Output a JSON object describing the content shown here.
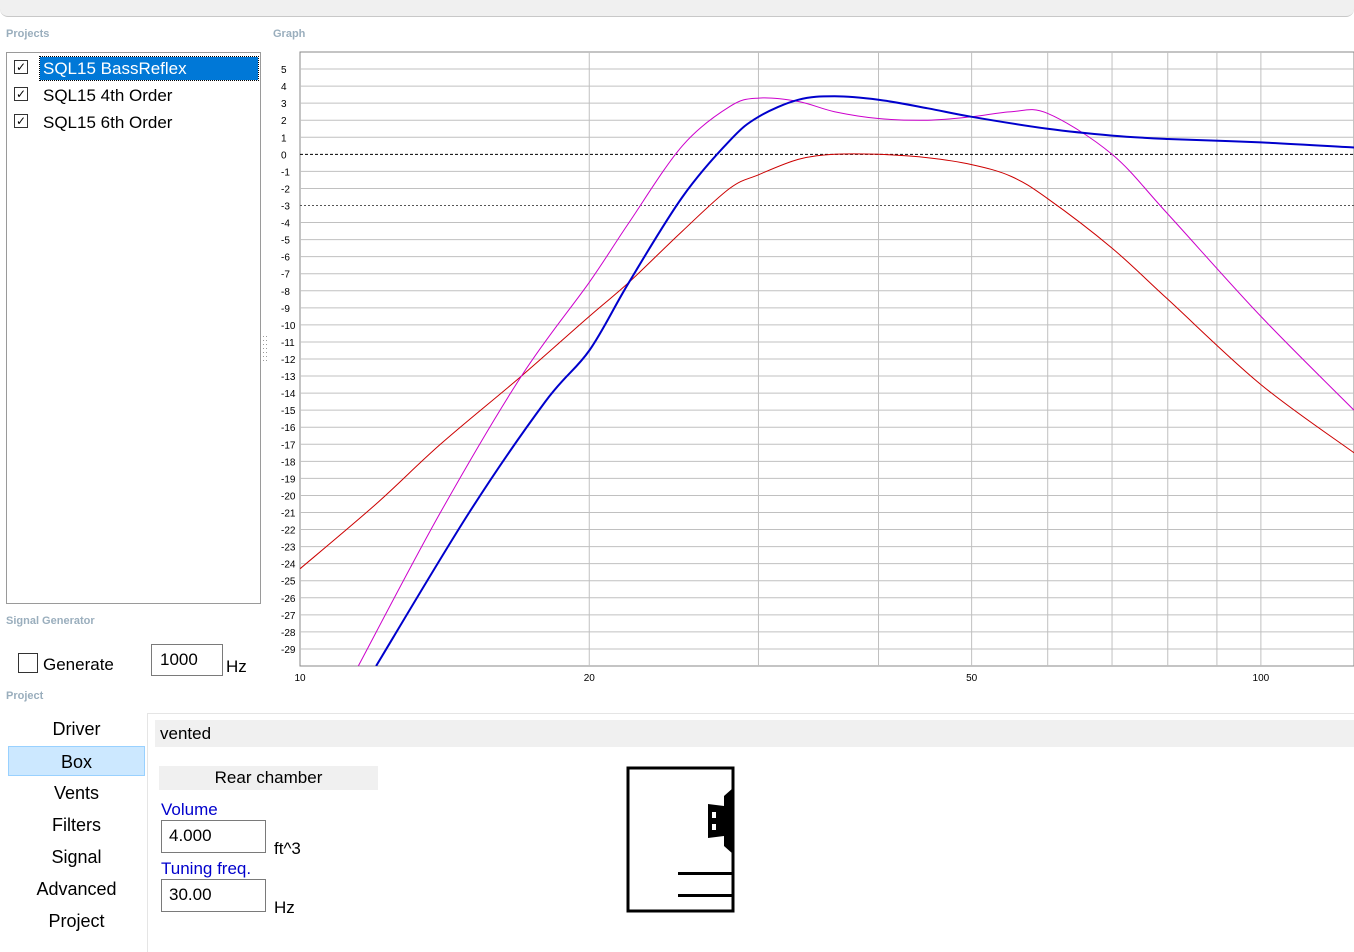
{
  "sections": {
    "projects": "Projects",
    "graph": "Graph",
    "signal_generator": "Signal Generator",
    "project": "Project"
  },
  "projects": [
    {
      "name": "SQL15 BassReflex",
      "checked": true,
      "selected": true
    },
    {
      "name": "SQL15 4th Order",
      "checked": true,
      "selected": false
    },
    {
      "name": "SQL15 6th Order",
      "checked": true,
      "selected": false
    }
  ],
  "signal": {
    "generate_label": "Generate",
    "generate_checked": false,
    "frequency": "1000",
    "unit": "Hz"
  },
  "nav": [
    {
      "label": "Driver",
      "active": false
    },
    {
      "label": "Box",
      "active": true
    },
    {
      "label": "Vents",
      "active": false
    },
    {
      "label": "Filters",
      "active": false
    },
    {
      "label": "Signal",
      "active": false
    },
    {
      "label": "Advanced",
      "active": false
    },
    {
      "label": "Project",
      "active": false
    }
  ],
  "box": {
    "type": "vented",
    "chamber_button": "Rear chamber",
    "volume_label": "Volume",
    "volume_value": "4.000",
    "volume_unit": "ft^3",
    "tuning_label": "Tuning freq.",
    "tuning_value": "30.00",
    "tuning_unit": "Hz"
  },
  "chart_data": {
    "type": "line",
    "title": "",
    "xlabel": "",
    "ylabel": "",
    "x_scale": "log",
    "xlim": [
      10,
      125
    ],
    "ylim": [
      -30,
      6
    ],
    "x_ticks": [
      10,
      20,
      50,
      100
    ],
    "y_ticks": [
      5,
      4,
      3,
      2,
      1,
      0,
      -1,
      -2,
      -3,
      -4,
      -5,
      -6,
      -7,
      -8,
      -9,
      -10,
      -11,
      -12,
      -13,
      -14,
      -15,
      -16,
      -17,
      -18,
      -19,
      -20,
      -21,
      -22,
      -23,
      -24,
      -25,
      -26,
      -27,
      -28,
      -29
    ],
    "reference_lines": [
      0,
      -3
    ],
    "grid": true,
    "series": [
      {
        "color": "#0000cc",
        "x": [
          12,
          15,
          18,
          20,
          22,
          25,
          28,
          30,
          33,
          36,
          40,
          45,
          50,
          60,
          70,
          80,
          100,
          125
        ],
        "y": [
          -30,
          -21,
          -14.5,
          -11.5,
          -7.5,
          -2.5,
          0.8,
          2.2,
          3.2,
          3.4,
          3.2,
          2.7,
          2.2,
          1.5,
          1.1,
          0.9,
          0.7,
          0.4
        ]
      },
      {
        "color": "#cc00cc",
        "x": [
          11.5,
          14,
          17,
          20,
          22,
          25,
          28,
          30,
          33,
          36,
          40,
          45,
          50,
          55,
          60,
          70,
          80,
          100,
          125
        ],
        "y": [
          -30,
          -21,
          -13,
          -7.5,
          -4,
          0.5,
          2.8,
          3.3,
          3.1,
          2.5,
          2.1,
          2.0,
          2.2,
          2.5,
          2.4,
          0,
          -3.5,
          -9.5,
          -15
        ]
      },
      {
        "color": "#cc0000",
        "x": [
          10,
          12,
          14,
          17,
          20,
          22,
          25,
          28,
          30,
          33,
          36,
          40,
          45,
          50,
          55,
          60,
          70,
          80,
          100,
          125
        ],
        "y": [
          -24.3,
          -20.5,
          -17,
          -13,
          -9.5,
          -7.5,
          -4.5,
          -2,
          -1.2,
          -0.3,
          0,
          0,
          -0.2,
          -0.6,
          -1.3,
          -2.6,
          -5.5,
          -8.5,
          -13.5,
          -17.5
        ]
      }
    ]
  }
}
